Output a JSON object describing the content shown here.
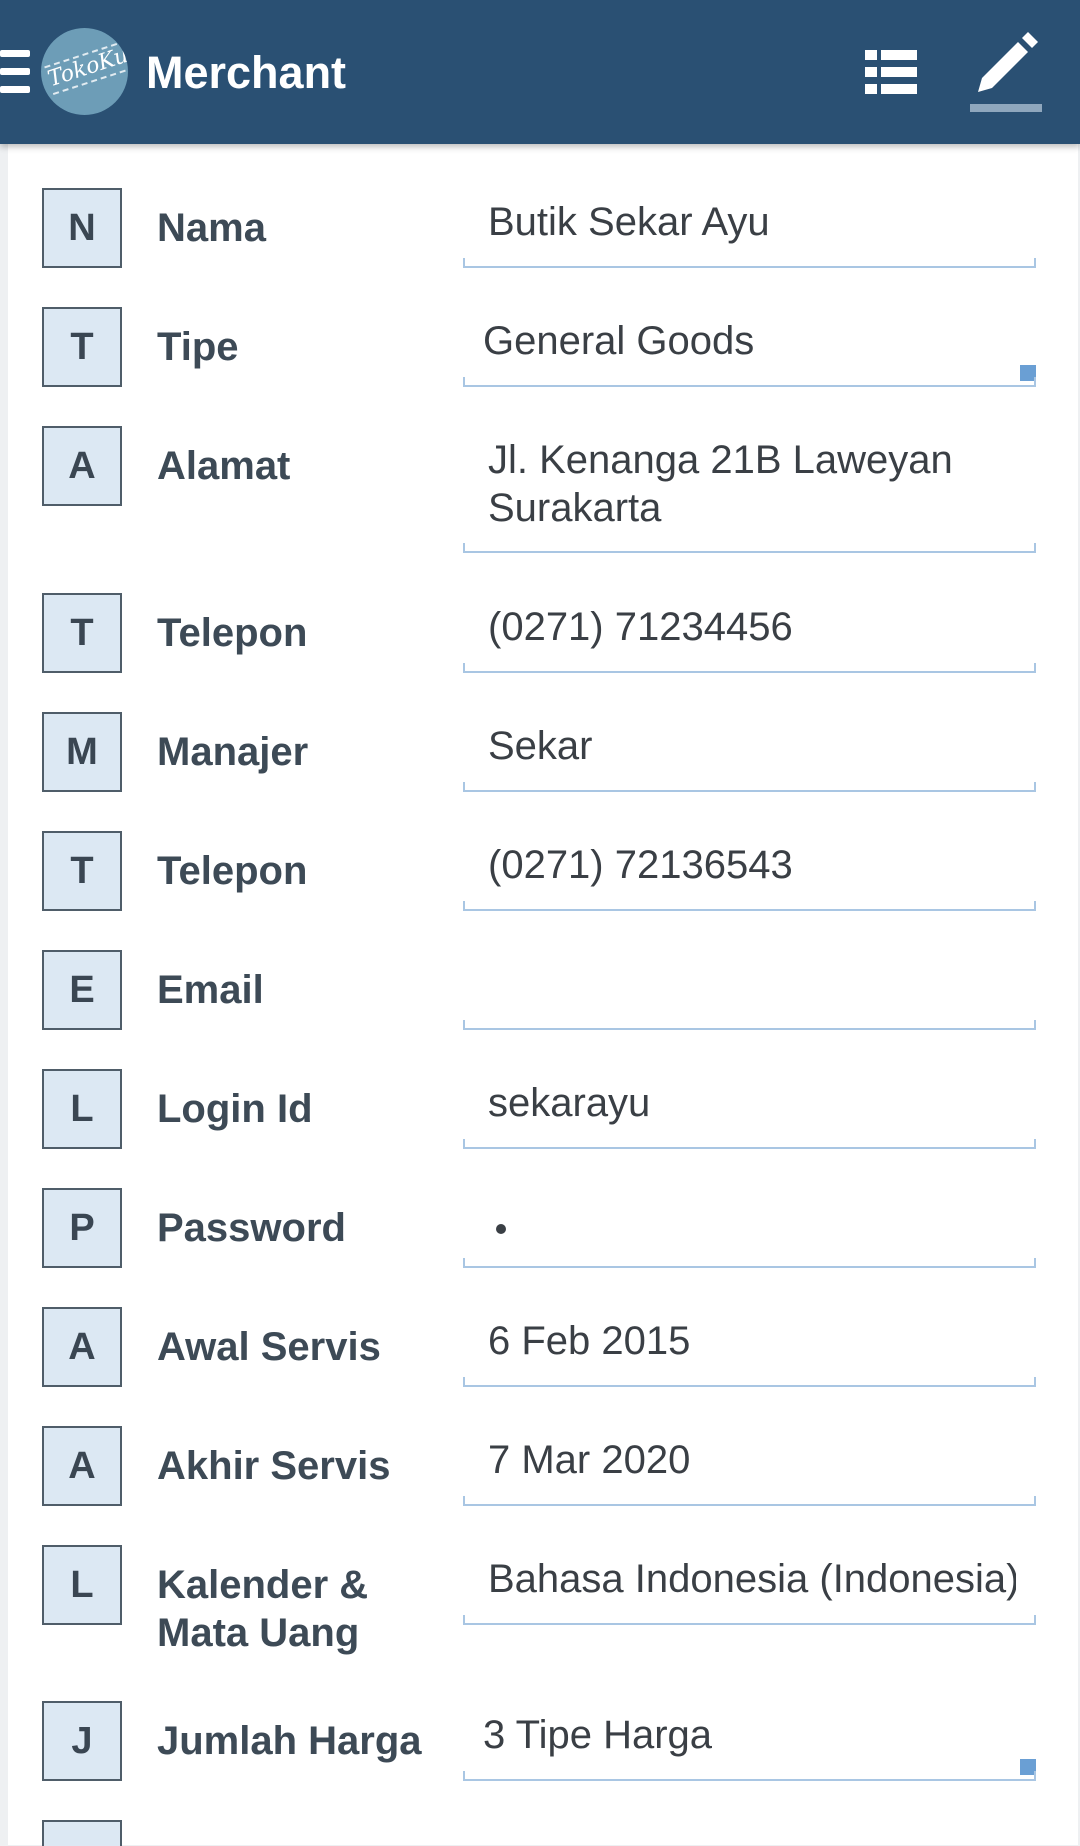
{
  "header": {
    "logo_text": "TokoKu",
    "title": "Merchant",
    "icons": {
      "menu": "hamburger-menu-icon",
      "list": "list-view-icon",
      "edit": "pencil-edit-icon"
    },
    "colors": {
      "bar": "#2a5073",
      "badge_bg": "#dce8f3",
      "underline": "#a9c6e3"
    }
  },
  "fields": [
    {
      "initial": "N",
      "label": "Nama",
      "value": "Butik Sekar Ayu"
    },
    {
      "initial": "T",
      "label": "Tipe",
      "value": "General Goods"
    },
    {
      "initial": "A",
      "label": "Alamat",
      "value": "Jl. Kenanga 21B Laweyan Surakarta"
    },
    {
      "initial": "T",
      "label": "Telepon",
      "value": "(0271) 71234456"
    },
    {
      "initial": "M",
      "label": "Manajer",
      "value": "Sekar"
    },
    {
      "initial": "T",
      "label": "Telepon",
      "value": "(0271) 72136543"
    },
    {
      "initial": "E",
      "label": "Email",
      "value": ""
    },
    {
      "initial": "L",
      "label": "Login Id",
      "value": "sekarayu"
    },
    {
      "initial": "P",
      "label": "Password",
      "value": ""
    },
    {
      "initial": "A",
      "label": "Awal Servis",
      "value": "6 Feb 2015"
    },
    {
      "initial": "A",
      "label": "Akhir Servis",
      "value": "7 Mar 2020"
    },
    {
      "initial": "L",
      "label": "Kalender & Mata Uang",
      "value": "Bahasa Indonesia (Indonesia)"
    },
    {
      "initial": "J",
      "label": "Jumlah Harga",
      "value": "3 Tipe Harga"
    }
  ]
}
